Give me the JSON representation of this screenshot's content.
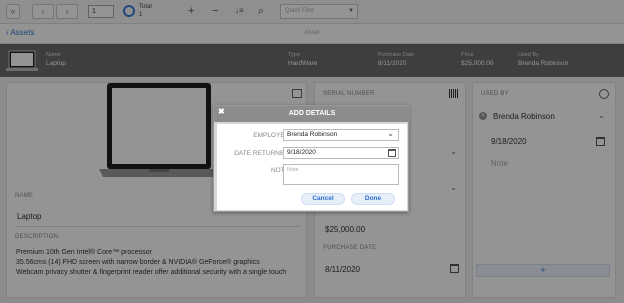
{
  "toolbar": {
    "nav_first": "«",
    "nav_prev": "‹",
    "nav_next": "›",
    "nav_last": "»",
    "page_number": "1",
    "total_label": "Total",
    "total_value": "1",
    "add_icon": "+",
    "remove_icon": "−",
    "sort_icon": "↓≡",
    "search_icon": "⌕",
    "quickfind_placeholder": "Quick Find"
  },
  "breadcrumb": {
    "back_label": "Assets",
    "page_title": "Asset"
  },
  "summary": {
    "columns": [
      {
        "caption": "Name",
        "value": "Laptop"
      },
      {
        "caption": "Type",
        "value": "HardWare"
      },
      {
        "caption": "Purchase Date",
        "value": "8/11/2020"
      },
      {
        "caption": "Price",
        "value": "$25,000.00"
      },
      {
        "caption": "Used By",
        "value": "Brenda Robinson"
      }
    ]
  },
  "details": {
    "name_caption": "NAME",
    "name_value": "Laptop",
    "description_caption": "DESCRIPTION",
    "description_value": "Premium 10th Gen Intel® Core™ processor\n35.56cms (14) FHD screen with narrow border & NVIDIA® GeForce® graphics\nWebcam privacy shutter & fingerprint reader offer additional security with a single touch"
  },
  "specs": {
    "serial_caption": "SERIAL NUMBER",
    "price_value": "$25,000.00",
    "purchase_date_caption": "PURCHASE DATE",
    "purchase_date_value": "8/11/2020"
  },
  "used_by": {
    "caption": "USED BY",
    "employee": "Brenda Robinson",
    "date": "9/18/2020",
    "note_placeholder": "Note",
    "add_label": "+"
  },
  "modal": {
    "title": "ADD DETAILS",
    "close_label": "✖",
    "employee_label": "EMPLOYEE",
    "employee_value": "Brenda Robinson",
    "date_returned_label": "DATE RETURNED",
    "date_returned_value": "9/18/2020",
    "note_label": "NOTE",
    "note_placeholder": "Note",
    "cancel_label": "Cancel",
    "done_label": "Done"
  },
  "colors": {
    "accent": "#3a7bd5",
    "header": "#6b6b6b",
    "overlay": "rgba(0,0,0,0.42)"
  }
}
